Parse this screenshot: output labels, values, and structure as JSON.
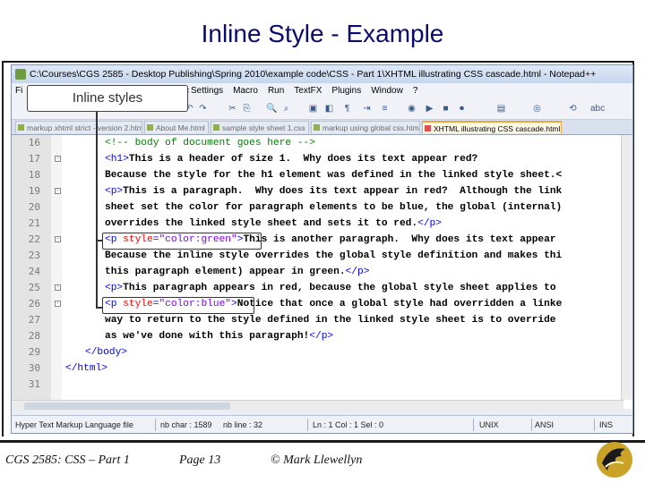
{
  "slide": {
    "title": "Inline Style - Example",
    "callout_label": "Inline styles",
    "footer": {
      "course": "CGS 2585: CSS – Part 1",
      "page": "Page 13",
      "author": "© Mark Llewellyn"
    }
  },
  "window": {
    "title": "C:\\Courses\\CGS 2585 - Desktop Publishing\\Spring 2010\\example code\\CSS - Part 1\\XHTML illustrating CSS cascade.html - Notepad++",
    "menu_left": "Fi",
    "menu_left_tail": "c",
    "menu": [
      "Settings",
      "Macro",
      "Run",
      "TextFX",
      "Plugins",
      "Window",
      "?"
    ],
    "tabs": [
      "markup xhtml strict - version 2.html",
      "About Me.html",
      "sample style sheet 1.css",
      "markup using global css.html",
      "XHTML illustrating CSS cascade.html"
    ],
    "status": {
      "filetype": "Hyper Text Markup Language file",
      "nb_char": "nb char : 1589",
      "nb_line": "nb line : 32",
      "position": "Ln : 1   Col : 1   Sel : 0",
      "eol": "UNIX",
      "encoding": "ANSI",
      "mode": "INS"
    }
  },
  "editor": {
    "lines": [
      {
        "num": "16",
        "fold": "",
        "parts": [
          {
            "c": "cmt",
            "t": "<!-- body of document goes here -->"
          }
        ]
      },
      {
        "num": "17",
        "fold": "-",
        "parts": [
          {
            "c": "tag",
            "t": "<h1>"
          },
          {
            "c": "txt",
            "t": "This is a header of size 1.  Why does its text appear red?"
          }
        ]
      },
      {
        "num": "18",
        "fold": "",
        "parts": [
          {
            "c": "txt",
            "t": "Because the style for the h1 element was defined in the linked style sheet.<"
          }
        ]
      },
      {
        "num": "19",
        "fold": "-",
        "parts": [
          {
            "c": "tag",
            "t": "<p>"
          },
          {
            "c": "txt",
            "t": "This is a paragraph.  Why does its text appear in red?  Although the link"
          }
        ]
      },
      {
        "num": "20",
        "fold": "",
        "parts": [
          {
            "c": "txt",
            "t": "sheet set the color for paragraph elements to be blue, the global (internal)"
          }
        ]
      },
      {
        "num": "21",
        "fold": "",
        "parts": [
          {
            "c": "txt",
            "t": "overrides the linked style sheet and sets it to red."
          },
          {
            "c": "tag",
            "t": "</p>"
          }
        ]
      },
      {
        "num": "22",
        "fold": "-",
        "parts": [
          {
            "c": "tag",
            "t": "<p "
          },
          {
            "c": "attr",
            "t": "style"
          },
          {
            "c": "tag",
            "t": "="
          },
          {
            "c": "val",
            "t": "\"color:green\""
          },
          {
            "c": "tag",
            "t": ">"
          },
          {
            "c": "txt",
            "t": "This is another paragraph.  Why does its text appear"
          }
        ]
      },
      {
        "num": "23",
        "fold": "",
        "parts": [
          {
            "c": "txt",
            "t": "Because the inline style overrides the global style definition and makes thi"
          }
        ]
      },
      {
        "num": "24",
        "fold": "",
        "parts": [
          {
            "c": "txt",
            "t": "this paragraph element) appear in green."
          },
          {
            "c": "tag",
            "t": "</p>"
          }
        ]
      },
      {
        "num": "25",
        "fold": "-",
        "parts": [
          {
            "c": "tag",
            "t": "<p>"
          },
          {
            "c": "txt",
            "t": "This paragraph appears in red, because the global style sheet applies to"
          }
        ]
      },
      {
        "num": "26",
        "fold": "-",
        "parts": [
          {
            "c": "tag",
            "t": "<p "
          },
          {
            "c": "attr",
            "t": "style"
          },
          {
            "c": "tag",
            "t": "="
          },
          {
            "c": "val",
            "t": "\"color:blue\""
          },
          {
            "c": "tag",
            "t": ">"
          },
          {
            "c": "txt",
            "t": "Notice that once a global style had overridden a linke"
          }
        ]
      },
      {
        "num": "27",
        "fold": "",
        "parts": [
          {
            "c": "txt",
            "t": "way to return to the style defined in the linked style sheet is to override"
          }
        ]
      },
      {
        "num": "28",
        "fold": "",
        "parts": [
          {
            "c": "txt",
            "t": "as we've done with this paragraph!"
          },
          {
            "c": "tag",
            "t": "</p>"
          }
        ]
      },
      {
        "num": "29",
        "fold": "",
        "indent": 2,
        "parts": [
          {
            "c": "tag",
            "t": "</body>"
          }
        ]
      },
      {
        "num": "30",
        "fold": "",
        "indent": 0,
        "parts": [
          {
            "c": "tag",
            "t": "</html>"
          }
        ]
      },
      {
        "num": "31",
        "fold": "",
        "parts": []
      }
    ]
  }
}
